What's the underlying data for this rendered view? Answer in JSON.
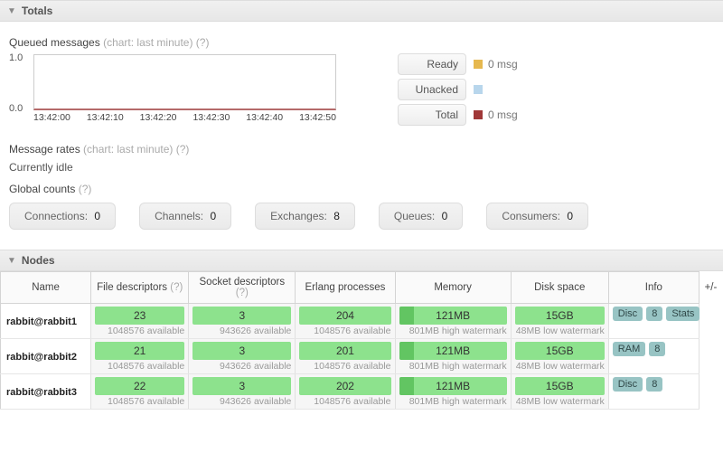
{
  "sections": {
    "totals": "Totals",
    "nodes": "Nodes"
  },
  "queued": {
    "label": "Queued messages",
    "muted": "(chart: last minute)",
    "help": "(?)",
    "y_top": "1.0",
    "y_bot": "0.0",
    "x": [
      "13:42:00",
      "13:42:10",
      "13:42:20",
      "13:42:30",
      "13:42:40",
      "13:42:50"
    ],
    "legend": [
      {
        "label": "Ready",
        "swatch": "#e6b84f",
        "value": "0 msg"
      },
      {
        "label": "Unacked",
        "swatch": "#b8d6ec",
        "value": ""
      },
      {
        "label": "Total",
        "swatch": "#a03838",
        "value": "0 msg"
      }
    ]
  },
  "rates": {
    "label": "Message rates",
    "muted": "(chart: last minute)",
    "help": "(?)",
    "idle": "Currently idle"
  },
  "global": {
    "label": "Global counts",
    "help": "(?)",
    "items": [
      {
        "label": "Connections:",
        "value": "0"
      },
      {
        "label": "Channels:",
        "value": "0"
      },
      {
        "label": "Exchanges:",
        "value": "8"
      },
      {
        "label": "Queues:",
        "value": "0"
      },
      {
        "label": "Consumers:",
        "value": "0"
      }
    ]
  },
  "nodes_table": {
    "plus_minus": "+/-",
    "help": "(?)",
    "headers": [
      "Name",
      "File descriptors",
      "Socket descriptors",
      "Erlang processes",
      "Memory",
      "Disk space",
      "Info"
    ],
    "rows": [
      {
        "name": "rabbit@rabbit1",
        "fd": {
          "val": "23",
          "sub": "1048576 available"
        },
        "sd": {
          "val": "3",
          "sub": "943626 available"
        },
        "ep": {
          "val": "204",
          "sub": "1048576 available"
        },
        "mem": {
          "val": "121MB",
          "sub": "801MB high watermark"
        },
        "disk": {
          "val": "15GB",
          "sub": "48MB low watermark"
        },
        "info": [
          "Disc",
          "8",
          "Stats"
        ]
      },
      {
        "name": "rabbit@rabbit2",
        "fd": {
          "val": "21",
          "sub": "1048576 available"
        },
        "sd": {
          "val": "3",
          "sub": "943626 available"
        },
        "ep": {
          "val": "201",
          "sub": "1048576 available"
        },
        "mem": {
          "val": "121MB",
          "sub": "801MB high watermark"
        },
        "disk": {
          "val": "15GB",
          "sub": "48MB low watermark"
        },
        "info": [
          "RAM",
          "8"
        ]
      },
      {
        "name": "rabbit@rabbit3",
        "fd": {
          "val": "22",
          "sub": "1048576 available"
        },
        "sd": {
          "val": "3",
          "sub": "943626 available"
        },
        "ep": {
          "val": "202",
          "sub": "1048576 available"
        },
        "mem": {
          "val": "121MB",
          "sub": "801MB high watermark"
        },
        "disk": {
          "val": "15GB",
          "sub": "48MB low watermark"
        },
        "info": [
          "Disc",
          "8"
        ]
      }
    ]
  },
  "chart_data": {
    "type": "line",
    "title": "Queued messages (last minute)",
    "x": [
      "13:42:00",
      "13:42:10",
      "13:42:20",
      "13:42:30",
      "13:42:40",
      "13:42:50"
    ],
    "series": [
      {
        "name": "Ready",
        "values": [
          0,
          0,
          0,
          0,
          0,
          0
        ]
      },
      {
        "name": "Unacked",
        "values": [
          0,
          0,
          0,
          0,
          0,
          0
        ]
      },
      {
        "name": "Total",
        "values": [
          0,
          0,
          0,
          0,
          0,
          0
        ]
      }
    ],
    "ylim": [
      0,
      1
    ],
    "xlabel": "",
    "ylabel": ""
  }
}
